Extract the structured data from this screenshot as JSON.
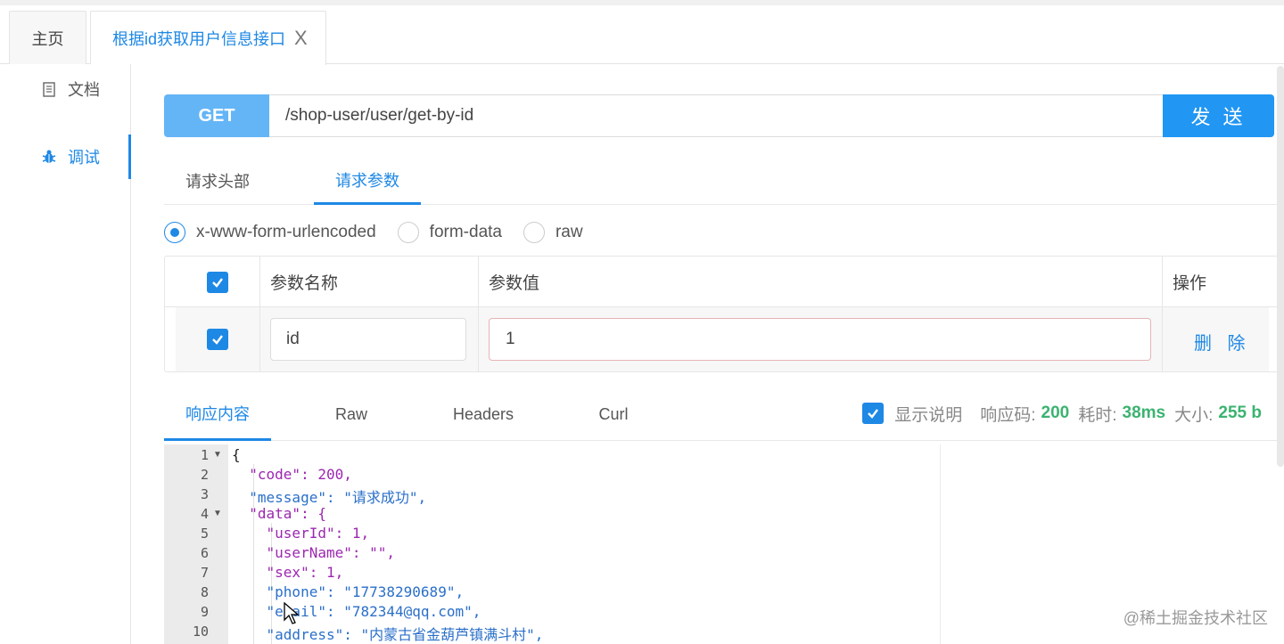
{
  "tabs": {
    "home": "主页",
    "api": "根据id获取用户信息接口",
    "close": "X"
  },
  "sidebar": {
    "items": [
      {
        "label": "文档",
        "icon": "document-icon"
      },
      {
        "label": "调试",
        "icon": "bug-icon"
      }
    ]
  },
  "request": {
    "method": "GET",
    "url": "/shop-user/user/get-by-id",
    "send_label": "发 送"
  },
  "request_tabs": [
    "请求头部",
    "请求参数"
  ],
  "body_types": [
    "x-www-form-urlencoded",
    "form-data",
    "raw"
  ],
  "params_table": {
    "headers": {
      "name": "参数名称",
      "value": "参数值",
      "action": "操作"
    },
    "rows": [
      {
        "name": "id",
        "value": "1",
        "action": "删 除"
      }
    ]
  },
  "response_tabs": [
    "响应内容",
    "Raw",
    "Headers",
    "Curl"
  ],
  "response_meta": {
    "show_desc_label": "显示说明",
    "code_label": "响应码:",
    "code_value": "200",
    "time_label": "耗时:",
    "time_value": "38ms",
    "size_label": "大小:",
    "size_value": "255 b"
  },
  "editor": {
    "line_numbers": [
      "1",
      "2",
      "3",
      "4",
      "5",
      "6",
      "7",
      "8",
      "9",
      "10"
    ],
    "lines": [
      "{",
      "  \"code\": 200,",
      "  \"message\": \"请求成功\",",
      "  \"data\": {",
      "    \"userId\": 1,",
      "    \"userName\": \"\",",
      "    \"sex\": 1,",
      "    \"phone\": \"17738290689\",",
      "    \"email\": \"782344@qq.com\",",
      "    \"address\": \"内蒙古省金葫芦镇满斗村\","
    ]
  },
  "watermark": "@稀土掘金技术社区",
  "colors": {
    "accent": "#1e88e5",
    "method_bg": "#64b5f6",
    "send_bg": "#2196f3",
    "success": "#3cb371"
  }
}
